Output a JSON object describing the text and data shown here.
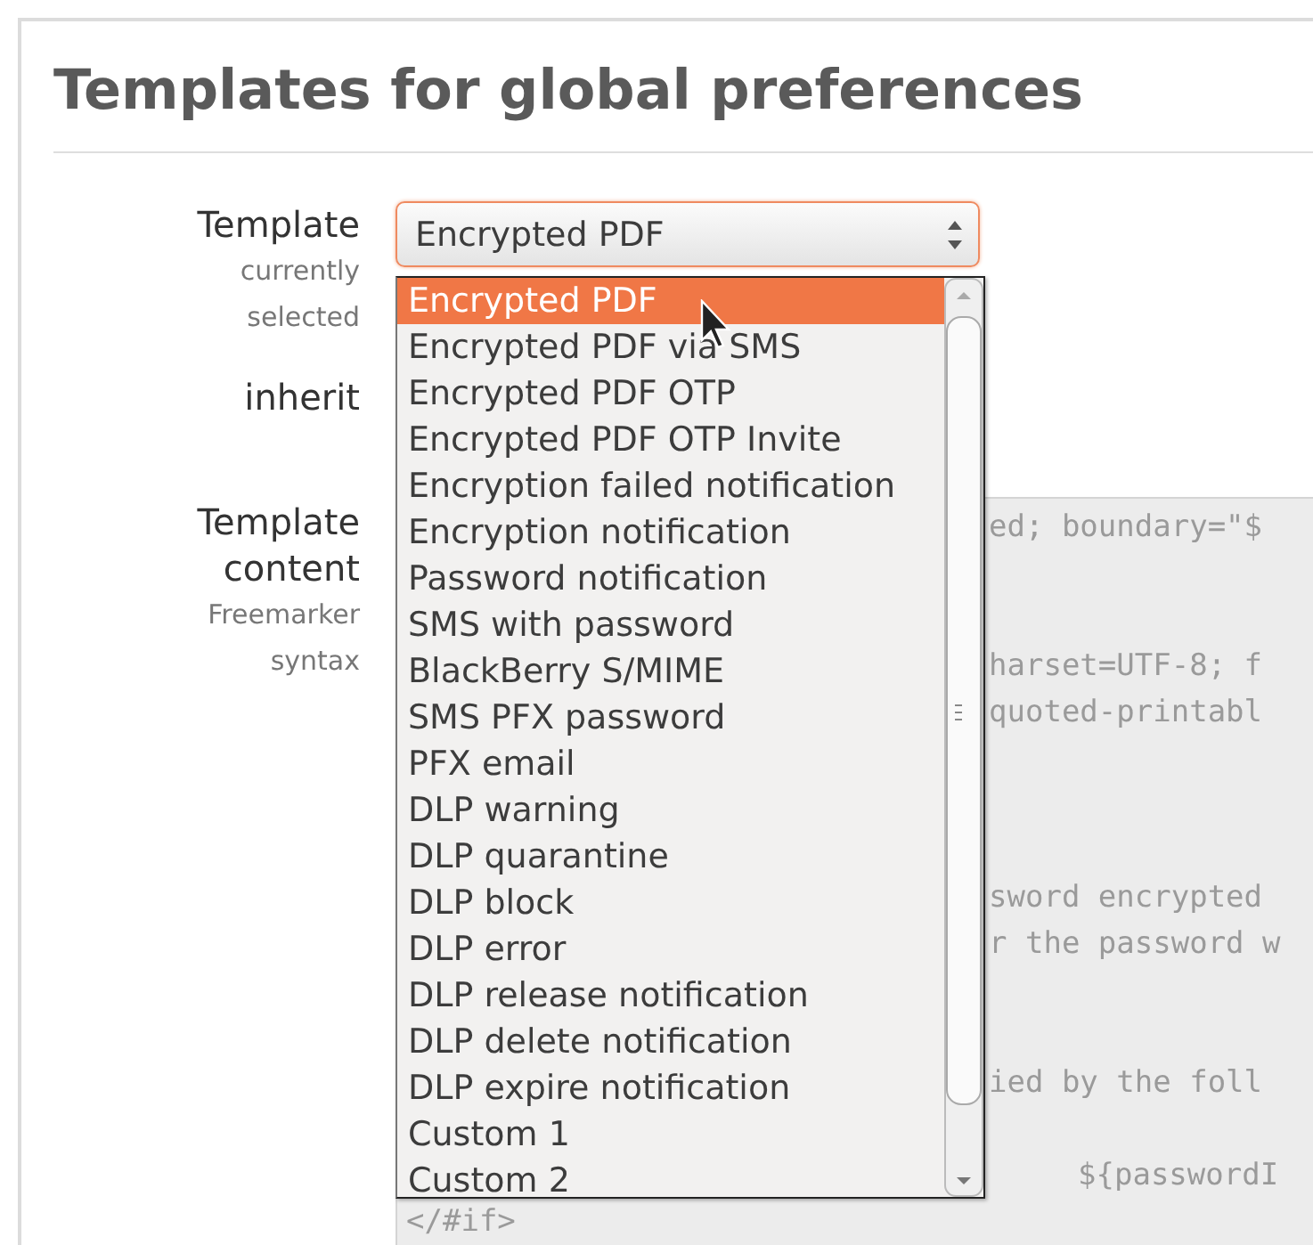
{
  "page": {
    "title": "Templates for global preferences"
  },
  "form": {
    "template": {
      "label": "Template",
      "hint": "currently selected",
      "value": "Encrypted PDF"
    },
    "inherit": {
      "label": "inherit"
    },
    "content": {
      "label": "Template content",
      "hint": "Freemarker syntax",
      "lines": [
        {
          "kind": "text",
          "text": "ed; boundary=\"$"
        },
        {
          "kind": "blank"
        },
        {
          "kind": "blank"
        },
        {
          "kind": "text",
          "text": "harset=UTF-8; f"
        },
        {
          "kind": "text",
          "text": "quoted-printabl"
        },
        {
          "kind": "blank"
        },
        {
          "kind": "blank"
        },
        {
          "kind": "blank"
        },
        {
          "kind": "text",
          "text": "sword encrypted"
        },
        {
          "kind": "text",
          "text": "r the password w"
        },
        {
          "kind": "blank"
        },
        {
          "kind": "blank"
        },
        {
          "kind": "text",
          "text": "ied by the foll"
        },
        {
          "kind": "blank"
        },
        {
          "kind": "indented",
          "text": "${passwordI"
        },
        {
          "kind": "full",
          "text": "</#if>"
        }
      ]
    }
  },
  "dropdown": {
    "expanded": true,
    "options": [
      {
        "label": "Encrypted PDF",
        "selected": true
      },
      {
        "label": "Encrypted PDF via SMS",
        "selected": false
      },
      {
        "label": "Encrypted PDF OTP",
        "selected": false
      },
      {
        "label": "Encrypted PDF OTP Invite",
        "selected": false
      },
      {
        "label": "Encryption failed notification",
        "selected": false
      },
      {
        "label": "Encryption notification",
        "selected": false
      },
      {
        "label": "Password notification",
        "selected": false
      },
      {
        "label": "SMS with password",
        "selected": false
      },
      {
        "label": "BlackBerry S/MIME",
        "selected": false
      },
      {
        "label": "SMS PFX password",
        "selected": false
      },
      {
        "label": "PFX email",
        "selected": false
      },
      {
        "label": "DLP warning",
        "selected": false
      },
      {
        "label": "DLP quarantine",
        "selected": false
      },
      {
        "label": "DLP block",
        "selected": false
      },
      {
        "label": "DLP error",
        "selected": false
      },
      {
        "label": "DLP release notification",
        "selected": false
      },
      {
        "label": "DLP delete notification",
        "selected": false
      },
      {
        "label": "DLP expire notification",
        "selected": false
      },
      {
        "label": "Custom 1",
        "selected": false
      },
      {
        "label": "Custom 2",
        "selected": false
      }
    ]
  }
}
